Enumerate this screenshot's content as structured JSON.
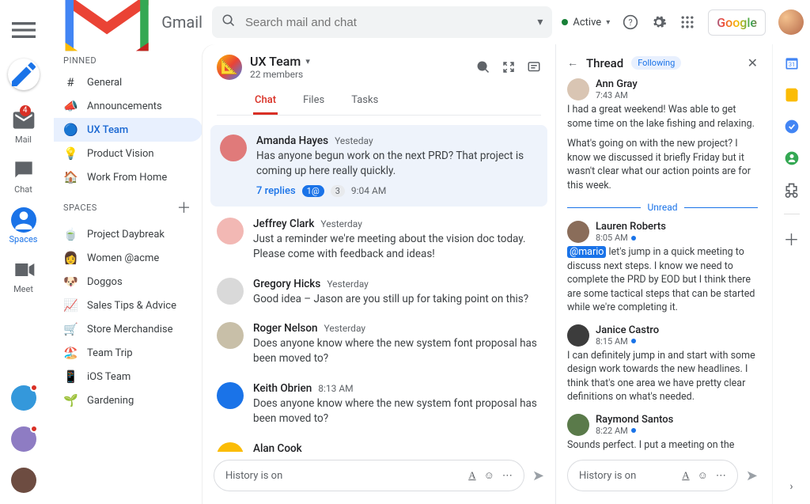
{
  "brand": "Gmail",
  "search": {
    "placeholder": "Search mail and chat"
  },
  "status": {
    "label": "Active"
  },
  "google_label": "Google",
  "rail": {
    "items": [
      {
        "key": "mail",
        "label": "Mail",
        "badge": "4"
      },
      {
        "key": "chat",
        "label": "Chat"
      },
      {
        "key": "spaces",
        "label": "Spaces",
        "active": true
      },
      {
        "key": "meet",
        "label": "Meet"
      }
    ]
  },
  "sidebar": {
    "pinned_label": "PINNED",
    "spaces_label": "SPACES",
    "pinned": [
      {
        "icon": "#",
        "label": "General"
      },
      {
        "icon": "📣",
        "label": "Announcements"
      },
      {
        "icon": "🔵",
        "label": "UX Team",
        "selected": true
      },
      {
        "icon": "💡",
        "label": "Product Vision"
      },
      {
        "icon": "🏠",
        "label": "Work From Home"
      }
    ],
    "spaces": [
      {
        "icon": "🍵",
        "label": "Project Daybreak"
      },
      {
        "icon": "👩",
        "label": "Women @acme"
      },
      {
        "icon": "🐶",
        "label": "Doggos"
      },
      {
        "icon": "📈",
        "label": "Sales Tips & Advice"
      },
      {
        "icon": "🛒",
        "label": "Store Merchandise"
      },
      {
        "icon": "🏖️",
        "label": "Team Trip"
      },
      {
        "icon": "📱",
        "label": "iOS Team"
      },
      {
        "icon": "🌱",
        "label": "Gardening"
      }
    ]
  },
  "chat": {
    "title": "UX Team",
    "subtitle": "22 members",
    "tabs": [
      "Chat",
      "Files",
      "Tasks"
    ],
    "active_tab": "Chat",
    "messages": [
      {
        "name": "Amanda Hayes",
        "ts": "Yesteday",
        "text": "Has anyone begun work on the next PRD? That project is coming up here really quickly.",
        "highlight": true,
        "replies": "7 replies",
        "pill1": "1@",
        "pill2": "3",
        "reply_ts": "9:04 AM",
        "avatar": "#e07a7a"
      },
      {
        "name": "Jeffrey Clark",
        "ts": "Yesterday",
        "text": "Just a reminder we're meeting about the vision doc today. Please come with feedback and ideas!",
        "avatar": "#f2b8b4"
      },
      {
        "name": "Gregory Hicks",
        "ts": "Yesterday",
        "text": "Good idea – Jason are you still up for taking point on this?",
        "avatar": "#d9d9d9"
      },
      {
        "name": "Roger Nelson",
        "ts": "Yesterday",
        "text": "Does anyone know where the new system font proposal has been moved to?",
        "avatar": "#c8bfa8"
      },
      {
        "name": "Keith Obrien",
        "ts": "8:13 AM",
        "text": "Does anyone know where the new system font proposal has been moved to?",
        "avatar": "#1a73e8"
      },
      {
        "name": "Alan Cook",
        "ts": "",
        "text": "",
        "avatar": "#fbbc05"
      }
    ],
    "composer_placeholder": "History is on"
  },
  "thread": {
    "title": "Thread",
    "following_label": "Following",
    "unread_label": "Unread",
    "messages": [
      {
        "name": "Ann Gray",
        "ts": "7:43 AM",
        "text": "I had a great weekend! Was able to get some time on the lake fishing and relaxing.",
        "text2": "What's going on with the new project? I know we discussed it briefly Friday but it wasn't clear what our action points are for this week.",
        "avatar": "#d9c5b3"
      },
      {
        "name": "Lauren Roberts",
        "ts": "8:05 AM",
        "unread_dot": true,
        "mention": "@mario",
        "text": "let's jump in a quick meeting to discuss next steps. I know we need to complete the PRD by EOD but I think there are some tactical steps that can be started while we're completing it.",
        "avatar": "#8a6d5a"
      },
      {
        "name": "Janice Castro",
        "ts": "8:15 AM",
        "unread_dot": true,
        "text": "I can definitely jump in and start with some design work towards the new headlines. I think that's one area we have pretty clear definitions on what's needed.",
        "avatar": "#3c3c3c"
      },
      {
        "name": "Raymond Santos",
        "ts": "8:22 AM",
        "unread_dot": true,
        "text": "Sounds perfect. I put a meeting on the calendar for later this morning so we can",
        "avatar": "#5a7a4a"
      }
    ],
    "composer_placeholder": "History is on"
  }
}
